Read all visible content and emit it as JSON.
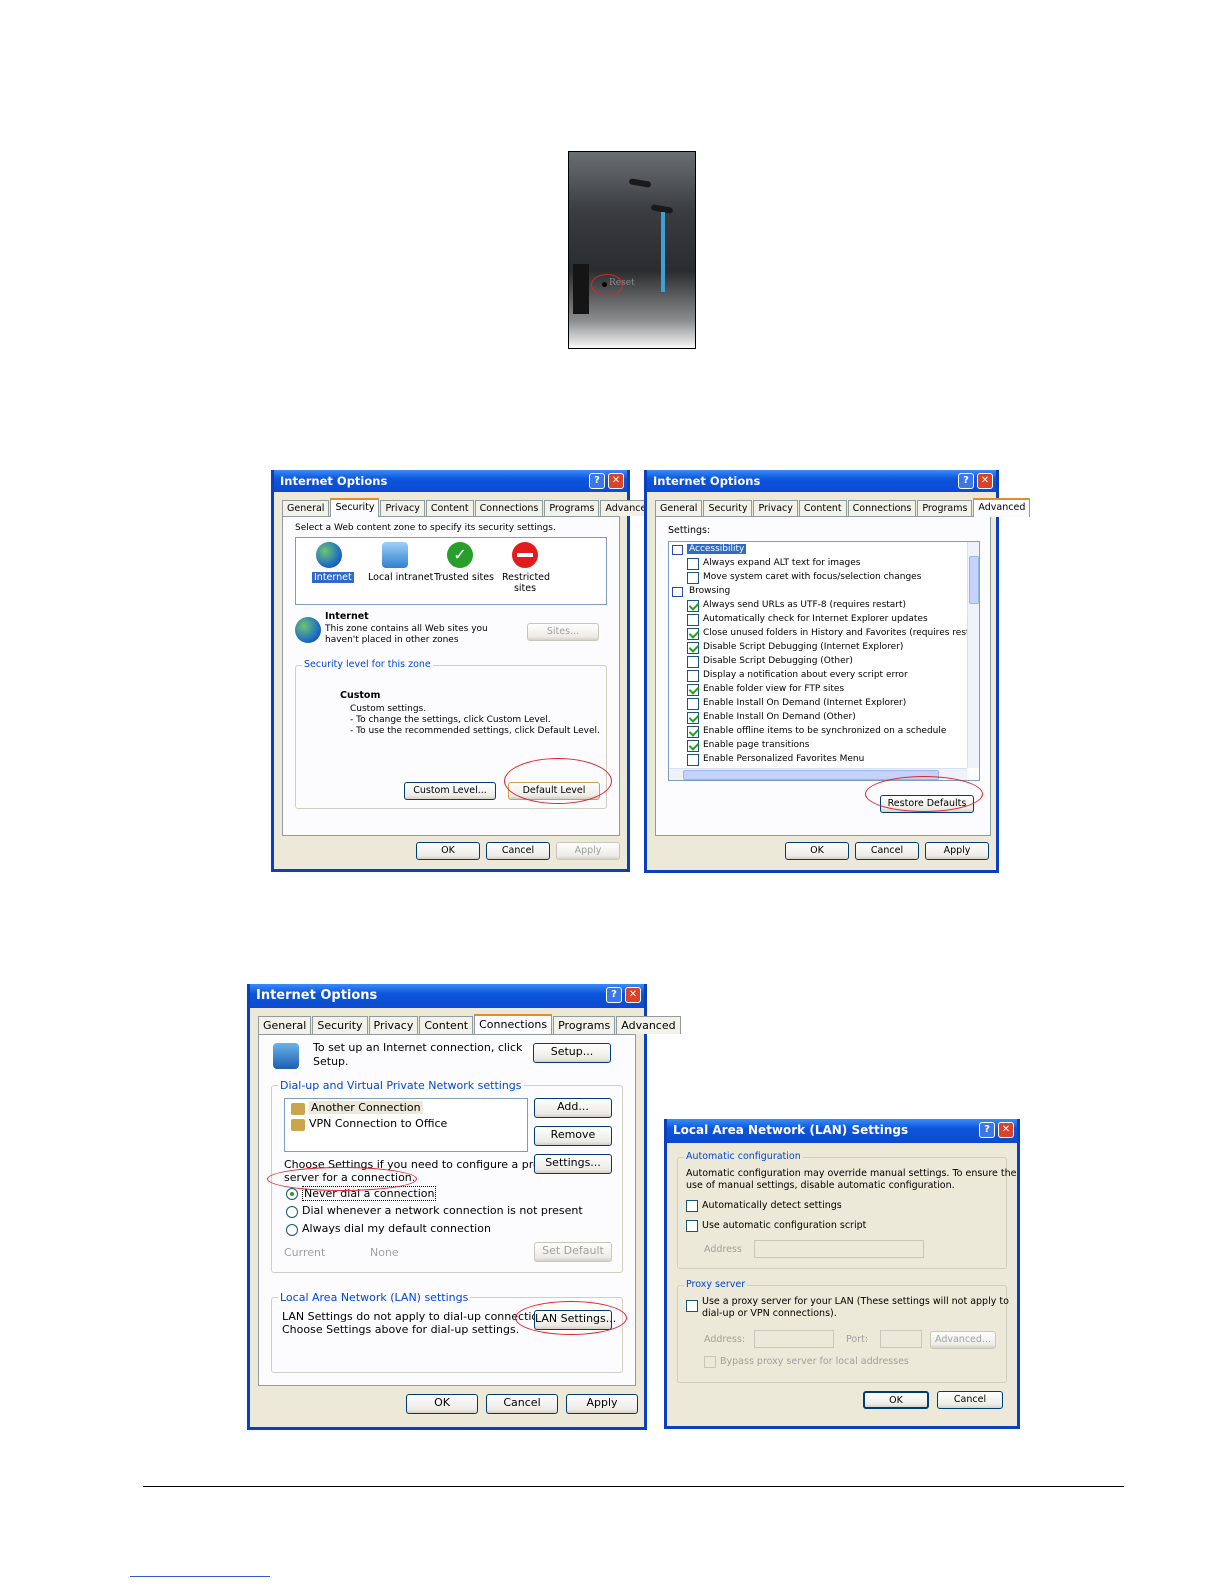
{
  "photo": {
    "label": "Reset"
  },
  "dialog1": {
    "title": "Internet Options",
    "tabs": [
      "General",
      "Security",
      "Privacy",
      "Content",
      "Connections",
      "Programs",
      "Advanced"
    ],
    "intro": "Select a Web content zone to specify its security settings.",
    "zones": [
      "Internet",
      "Local intranet",
      "Trusted sites",
      "Restricted sites"
    ],
    "zone_title": "Internet",
    "zone_desc_1": "This zone contains all Web sites you",
    "zone_desc_2": "haven't placed in other zones",
    "sites_button": "Sites...",
    "security_group": "Security level for this zone",
    "level_title": "Custom",
    "level_line_1": "Custom settings.",
    "level_line_2": "- To change the settings, click Custom Level.",
    "level_line_3": "- To use the recommended settings, click Default Level.",
    "custom_level_button": "Custom Level...",
    "default_level_button": "Default Level",
    "ok": "OK",
    "cancel": "Cancel",
    "apply": "Apply"
  },
  "dialog2": {
    "title": "Internet Options",
    "tabs": [
      "General",
      "Security",
      "Privacy",
      "Content",
      "Connections",
      "Programs",
      "Advanced"
    ],
    "settings_label": "Settings:",
    "items": [
      {
        "label": "Accessibility",
        "type": "category"
      },
      {
        "label": "Always expand ALT text for images",
        "checked": false
      },
      {
        "label": "Move system caret with focus/selection changes",
        "checked": false
      },
      {
        "label": "Browsing",
        "type": "category"
      },
      {
        "label": "Always send URLs as UTF-8 (requires restart)",
        "checked": true
      },
      {
        "label": "Automatically check for Internet Explorer updates",
        "checked": false
      },
      {
        "label": "Close unused folders in History and Favorites (requires restart)",
        "checked": true
      },
      {
        "label": "Disable Script Debugging (Internet Explorer)",
        "checked": true
      },
      {
        "label": "Disable Script Debugging (Other)",
        "checked": false
      },
      {
        "label": "Display a notification about every script error",
        "checked": false
      },
      {
        "label": "Enable folder view for FTP sites",
        "checked": true
      },
      {
        "label": "Enable Install On Demand (Internet Explorer)",
        "checked": false
      },
      {
        "label": "Enable Install On Demand (Other)",
        "checked": true
      },
      {
        "label": "Enable offline items to be synchronized on a schedule",
        "checked": true
      },
      {
        "label": "Enable page transitions",
        "checked": true
      },
      {
        "label": "Enable Personalized Favorites Menu",
        "checked": false
      }
    ],
    "restore_button": "Restore Defaults",
    "ok": "OK",
    "cancel": "Cancel",
    "apply": "Apply"
  },
  "dialog3": {
    "title": "Internet Options",
    "tabs": [
      "General",
      "Security",
      "Privacy",
      "Content",
      "Connections",
      "Programs",
      "Advanced"
    ],
    "setup_text_1": "To set up an Internet connection, click",
    "setup_text_2": "Setup.",
    "setup_button": "Setup...",
    "dialup_group": "Dial-up and Virtual Private Network settings",
    "connections": [
      "Another Connection",
      "VPN Connection to Office"
    ],
    "add_button": "Add...",
    "remove_button": "Remove",
    "settings_button": "Settings...",
    "proxy_text_1": "Choose Settings if you need to configure a proxy",
    "proxy_text_2": "server for a connection.",
    "radios": [
      {
        "label": "Never dial a connection",
        "selected": true
      },
      {
        "label": "Dial whenever a network connection is not present",
        "selected": false
      },
      {
        "label": "Always dial my default connection",
        "selected": false
      }
    ],
    "current_label": "Current",
    "current_value": "None",
    "set_default_button": "Set Default",
    "lan_group": "Local Area Network (LAN) settings",
    "lan_text_1": "LAN Settings do not apply to dial-up connections.",
    "lan_text_2": "Choose Settings above for dial-up settings.",
    "lan_button": "LAN Settings...",
    "ok": "OK",
    "cancel": "Cancel",
    "apply": "Apply"
  },
  "dialog4": {
    "title": "Local Area Network (LAN) Settings",
    "auto_group": "Automatic configuration",
    "auto_text_1": "Automatic configuration may override manual settings.  To ensure the",
    "auto_text_2": "use of manual settings, disable automatic configuration.",
    "auto_detect": "Automatically detect settings",
    "auto_script": "Use automatic configuration script",
    "address_label": "Address",
    "proxy_group": "Proxy server",
    "proxy_text_1": "Use a proxy server for your LAN (These settings will not apply to",
    "proxy_text_2": "dial-up or VPN connections).",
    "proxy_address_label": "Address:",
    "port_label": "Port:",
    "advanced_button": "Advanced...",
    "bypass_label": "Bypass proxy server for local addresses",
    "ok": "OK",
    "cancel": "Cancel"
  }
}
